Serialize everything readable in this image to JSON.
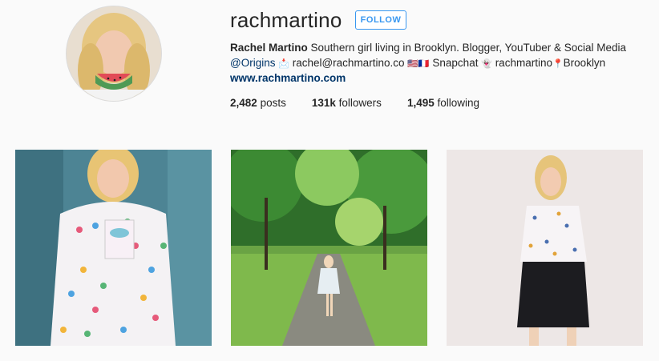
{
  "profile": {
    "username": "rachmartino",
    "follow_label": "FOLLOW",
    "full_name": "Rachel Martino",
    "bio_line1": "Southern girl living in Brooklyn. Blogger, YouTuber & Social Media",
    "bio_mention": "@Origins",
    "bio_line2_email": "rachel@rachmartino.co",
    "bio_line2_snapchat": "Snapchat",
    "bio_line2_snap_user": "rachmartino",
    "bio_line2_location": "Brooklyn",
    "website": "www.rachmartino.com"
  },
  "stats": {
    "posts_count": "2,482",
    "posts_label": "posts",
    "followers_count": "131k",
    "followers_label": "followers",
    "following_count": "1,495",
    "following_label": "following"
  },
  "icons": {
    "email": "envelope-icon",
    "flags": "us-france-flags-icon",
    "snapchat": "ghost-icon",
    "location": "pin-icon"
  },
  "colors": {
    "accent": "#3897f0",
    "link": "#003569",
    "background": "#fafafa"
  }
}
